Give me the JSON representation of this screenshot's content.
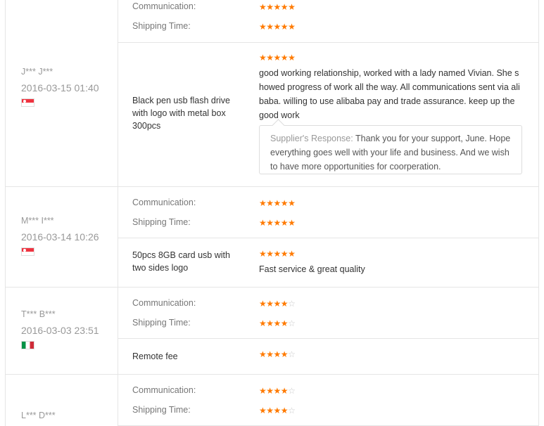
{
  "labels": {
    "communication": "Communication:",
    "shipping": "Shipping Time:"
  },
  "reviews": [
    {
      "buyer": "",
      "date": "",
      "communication_stars": 5,
      "shipping_stars": 5
    },
    {
      "buyer": "J*** J***",
      "date": "2016-03-15 01:40",
      "flag_icon": "singapore-flag-icon",
      "product": "Black pen usb flash drive with logo with metal box 300pcs",
      "product_stars": 5,
      "feedback": "good working relationship, worked with a lady named Vivian. She showed progress of work all the way. All communications sent via alibaba. willing to use alibaba pay and trade assurance. keep up the good work",
      "response_label": "Supplier's Response:",
      "response_text": "Thank you for your support, June. Hope everything goes well with your life and business. And we wish to have more opportunities for coorperation."
    },
    {
      "buyer": "M*** I***",
      "date": "2016-03-14 10:26",
      "flag_icon": "singapore-flag-icon",
      "communication_stars": 5,
      "shipping_stars": 5,
      "product": "50pcs 8GB card usb with two sides logo",
      "product_stars": 5,
      "feedback": "Fast service & great quality"
    },
    {
      "buyer": "T*** B***",
      "date": "2016-03-03 23:51",
      "flag_icon": "italy-flag-icon",
      "communication_stars": 4,
      "shipping_stars": 4,
      "product": "Remote fee",
      "product_stars": 4
    },
    {
      "buyer": "L*** D***",
      "communication_stars": 4,
      "shipping_stars": 4
    }
  ],
  "star_colors": {
    "on": "#ff7a00",
    "off": "#c8c8c8"
  }
}
